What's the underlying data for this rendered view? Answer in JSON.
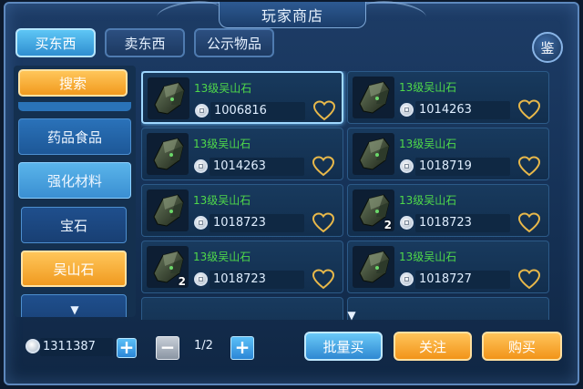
{
  "window": {
    "title": "玩家商店"
  },
  "tabs": [
    {
      "label": "买东西",
      "active": true
    },
    {
      "label": "卖东西",
      "active": false
    },
    {
      "label": "公示物品",
      "active": false
    }
  ],
  "appraise_label": "鉴",
  "sidebar": {
    "search_label": "搜索",
    "categories": [
      {
        "label": "药品食品"
      },
      {
        "label": "强化材料"
      },
      {
        "label": "宝石"
      },
      {
        "label": "吴山石"
      }
    ]
  },
  "items": [
    {
      "name": "13级吴山石",
      "price": "1006816",
      "qty": ""
    },
    {
      "name": "13级吴山石",
      "price": "1014263",
      "qty": ""
    },
    {
      "name": "13级吴山石",
      "price": "1014263",
      "qty": ""
    },
    {
      "name": "13级吴山石",
      "price": "1018719",
      "qty": ""
    },
    {
      "name": "13级吴山石",
      "price": "1018723",
      "qty": ""
    },
    {
      "name": "13级吴山石",
      "price": "1018723",
      "qty": "2"
    },
    {
      "name": "13级吴山石",
      "price": "1018723",
      "qty": "2"
    },
    {
      "name": "13级吴山石",
      "price": "1018727",
      "qty": ""
    }
  ],
  "footer": {
    "money": "1311387",
    "page": "1/2",
    "bulk_buy_label": "批量买",
    "follow_label": "关注",
    "buy_label": "购买"
  },
  "colors": {
    "item_name": "#4fd84a",
    "accent_orange": "#f29419",
    "accent_blue": "#2e88d2"
  }
}
